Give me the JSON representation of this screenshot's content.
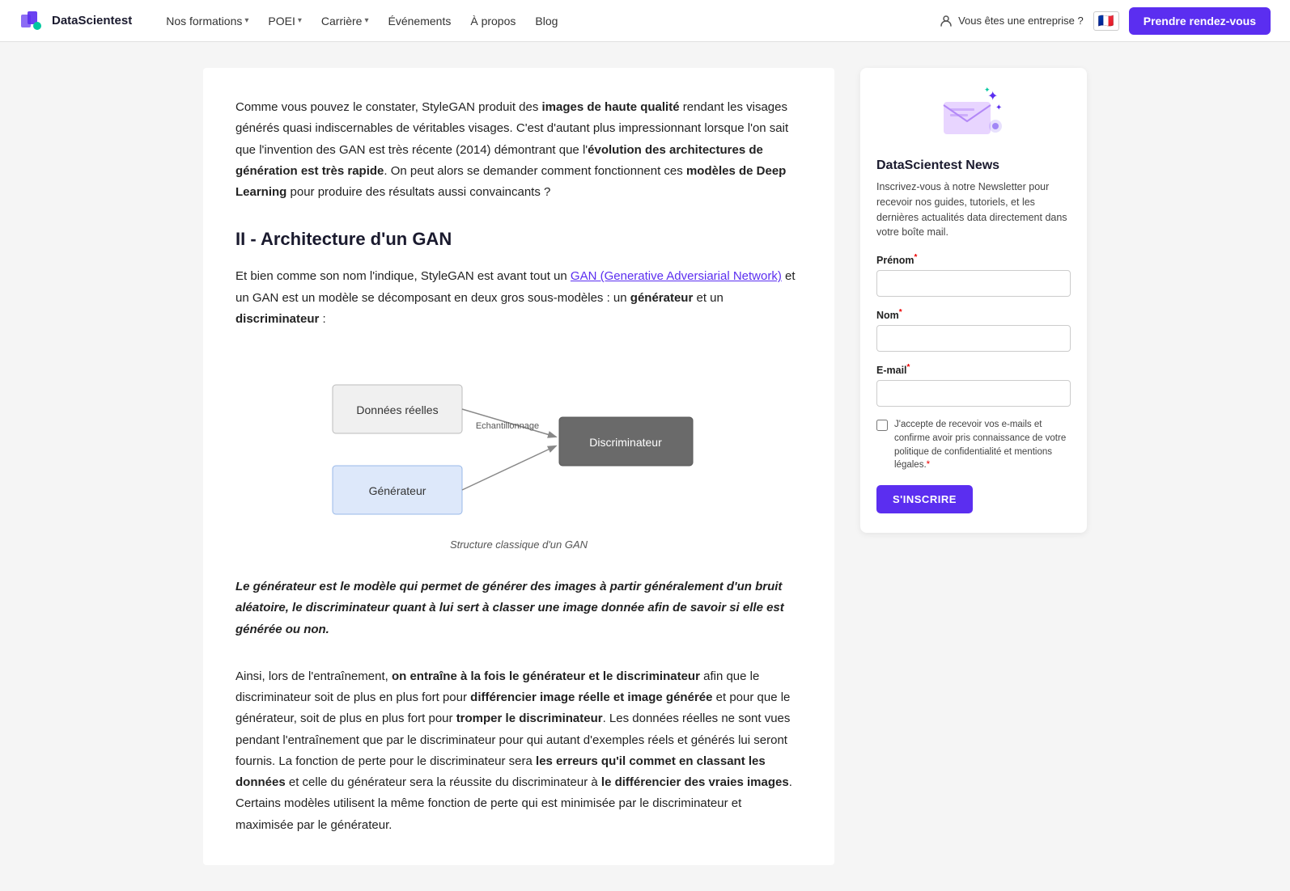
{
  "navbar": {
    "logo_text": "DataScientest",
    "nav_items": [
      {
        "label": "Nos formations",
        "has_dropdown": true
      },
      {
        "label": "POEI",
        "has_dropdown": true
      },
      {
        "label": "Carrière",
        "has_dropdown": true
      },
      {
        "label": "Événements",
        "has_dropdown": false
      },
      {
        "label": "À propos",
        "has_dropdown": false
      },
      {
        "label": "Blog",
        "has_dropdown": false
      }
    ],
    "enterprise_label": "Vous êtes une entreprise ?",
    "flag_emoji": "🇫🇷",
    "cta_label": "Prendre rendez-vous"
  },
  "article": {
    "intro_paragraph": "Comme vous pouvez le constater, StyleGAN produit des images de haute qualité rendant les visages générés quasi indiscernables de véritables visages. C'est d'autant plus impressionnant lorsque l'on sait que l'invention des GAN est très récente (2014) démontrant que l'évolution des architectures de génération est très rapide. On peut alors se demander comment fonctionnent ces modèles de Deep Learning pour produire des résultats aussi convaincants ?",
    "section_heading": "II - Architecture d'un GAN",
    "section_intro": "Et bien comme son nom l'indique, StyleGAN est avant tout un GAN (Generative Adversiarial Network) et un GAN est un modèle se décomposant en deux gros sous-modèles : un générateur et un discriminateur :",
    "section_link_text": "GAN (Generative Adversiarial Network)",
    "diagram_caption": "Structure classique d'un GAN",
    "diagram_labels": {
      "donnees_reelles": "Données réelles",
      "echantillonnage": "Echantillonnage",
      "discriminateur": "Discriminateur",
      "generateur": "Générateur"
    },
    "blockquote": "Le générateur est le modèle qui permet de générer des images à partir généralement d'un bruit aléatoire, le discriminateur quant à lui sert à classer une image donnée afin de savoir si elle est générée ou non.",
    "body_paragraph": "Ainsi, lors de l'entraînement, on entraîne à la fois le générateur et le discriminateur afin que le discriminateur soit de plus en plus fort pour différencier image réelle et image générée et pour que le générateur, soit de plus en plus fort pour tromper le discriminateur. Les données réelles ne sont vues pendant l'entraînement que par le discriminateur pour qui autant d'exemples réels et générés lui seront fournis. La fonction de perte pour le discriminateur sera les erreurs qu'il commet en classant les données et celle du générateur sera la réussite du discriminateur à le différencier des vraies images. Certains modèles utilisent la même fonction de perte qui est minimisée par le discriminateur et maximisée par le générateur."
  },
  "sidebar": {
    "newsletter_title": "DataScientest News",
    "newsletter_desc": "Inscrivez-vous à notre Newsletter pour recevoir nos guides, tutoriels, et les dernières actualités data directement dans votre boîte mail.",
    "form": {
      "prenom_label": "Prénom",
      "prenom_required": "*",
      "nom_label": "Nom",
      "nom_required": "*",
      "email_label": "E-mail",
      "email_required": "*",
      "checkbox_label": "J'accepte de recevoir vos e-mails et confirme avoir pris connaissance de votre politique de confidentialité et mentions légales.",
      "checkbox_required": "*",
      "subscribe_label": "S'INSCRIRE"
    }
  }
}
